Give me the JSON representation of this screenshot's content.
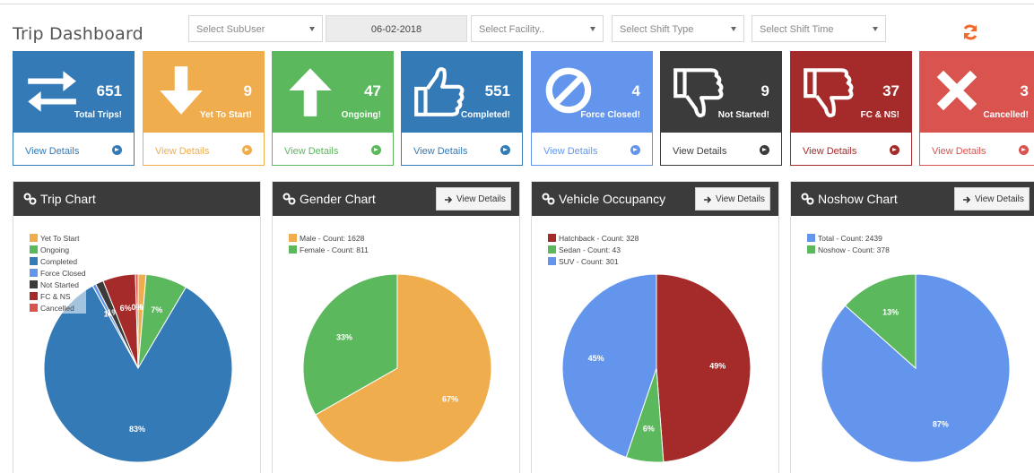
{
  "title": "Trip Dashboard",
  "filters": {
    "subuser": "Select SubUser",
    "date": "06-02-2018",
    "facility": "Select Facility..",
    "shift_type": "Select Shift Type",
    "shift_time": "Select Shift Time"
  },
  "tiles": [
    {
      "count": "651",
      "label": "Total Trips!",
      "link": "View Details",
      "icon": "swap-arrows-icon",
      "color": "#337ab7"
    },
    {
      "count": "9",
      "label": "Yet To Start!",
      "link": "View Details",
      "icon": "arrow-down-icon",
      "color": "#f0ad4e"
    },
    {
      "count": "47",
      "label": "Ongoing!",
      "link": "View Details",
      "icon": "arrow-up-icon",
      "color": "#5cb85c"
    },
    {
      "count": "551",
      "label": "Completed!",
      "link": "View Details",
      "icon": "thumbs-up-icon",
      "color": "#337ab7"
    },
    {
      "count": "4",
      "label": "Force Closed!",
      "link": "View Details",
      "icon": "ban-icon",
      "color": "#6495ed"
    },
    {
      "count": "9",
      "label": "Not Started!",
      "link": "View Details",
      "icon": "thumbs-down-icon",
      "color": "#3b3b3b"
    },
    {
      "count": "37",
      "label": "FC & NS!",
      "link": "View Details",
      "icon": "thumbs-down-icon",
      "color": "#a52a2a"
    },
    {
      "count": "3",
      "label": "Cancelled!",
      "link": "View Details",
      "icon": "close-icon",
      "color": "#d9534f"
    }
  ],
  "panels": {
    "trip": {
      "title": "Trip Chart"
    },
    "gender": {
      "title": "Gender Chart",
      "button": "View Details"
    },
    "vehicle": {
      "title": "Vehicle Occupancy",
      "button": "View Details"
    },
    "noshow": {
      "title": "Noshow Chart",
      "button": "View Details"
    }
  },
  "chart_data": [
    {
      "type": "pie",
      "title": "Trip Chart",
      "categories": [
        "Yet To Start",
        "Ongoing",
        "Completed",
        "Force Closed",
        "Not Started",
        "FC & NS",
        "Cancelled"
      ],
      "values": [
        9,
        47,
        551,
        4,
        9,
        37,
        3
      ],
      "colors": [
        "#f0ad4e",
        "#5cb85c",
        "#337ab7",
        "#6495ed",
        "#3b3b3b",
        "#a52a2a",
        "#d9534f"
      ],
      "slice_labels": [
        "1%",
        "7%",
        "83%",
        "1%",
        "1%",
        "6%",
        "0%"
      ]
    },
    {
      "type": "pie",
      "title": "Gender Chart",
      "categories": [
        "Male - Count: 1628",
        "Female - Count: 811"
      ],
      "values": [
        1628,
        811
      ],
      "colors": [
        "#f0ad4e",
        "#5cb85c"
      ],
      "slice_labels": [
        "67%",
        "33%"
      ]
    },
    {
      "type": "pie",
      "title": "Vehicle Occupancy",
      "categories": [
        "Hatchback - Count: 328",
        "Sedan - Count: 43",
        "SUV - Count: 301"
      ],
      "values": [
        328,
        43,
        301
      ],
      "colors": [
        "#a52a2a",
        "#5cb85c",
        "#6495ed"
      ],
      "slice_labels": [
        "49%",
        "6%",
        "45%"
      ]
    },
    {
      "type": "pie",
      "title": "Noshow Chart",
      "categories": [
        "Total - Count: 2439",
        "Noshow - Count: 378"
      ],
      "values": [
        2439,
        378
      ],
      "colors": [
        "#6495ed",
        "#5cb85c"
      ],
      "slice_labels": [
        "87%",
        "13%"
      ]
    }
  ]
}
